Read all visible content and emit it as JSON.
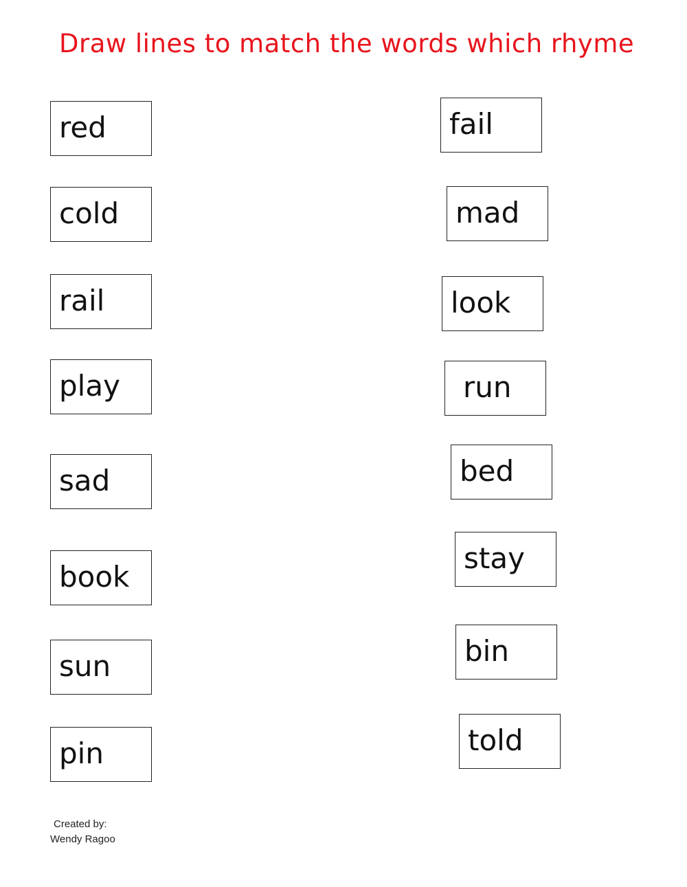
{
  "title": "Draw lines to match the words which rhyme",
  "left_words": [
    "red",
    "cold",
    "rail",
    "play",
    "sad",
    "book",
    "sun",
    "pin"
  ],
  "right_words": [
    "fail",
    "mad",
    "look",
    "run",
    "bed",
    "stay",
    "bin",
    "told"
  ],
  "credit": {
    "line1": "Created by:",
    "line2": "Wendy Ragoo"
  }
}
